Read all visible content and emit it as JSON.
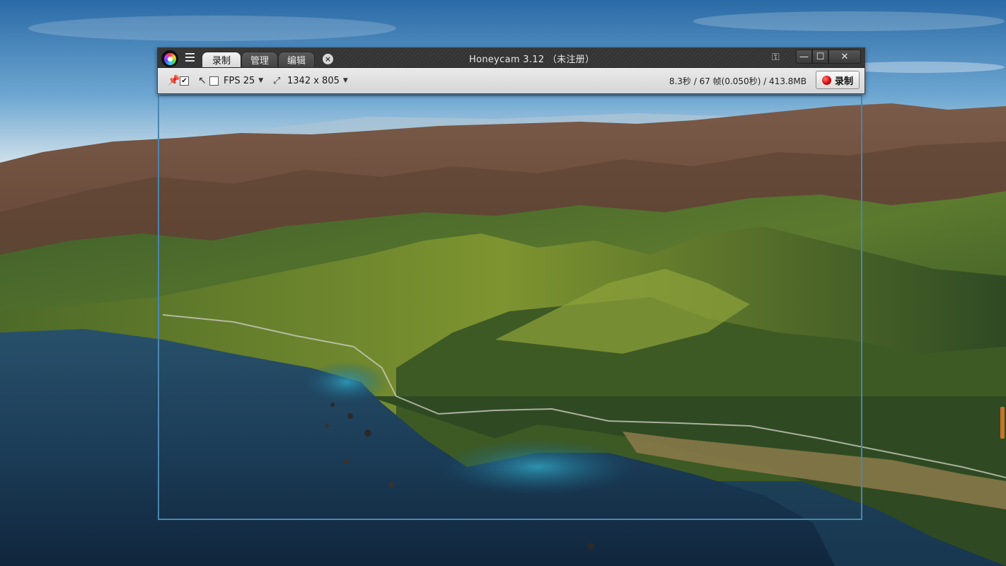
{
  "window": {
    "title": "Honeycam 3.12 （未注册）",
    "tabs": [
      {
        "label": "录制",
        "active": true
      },
      {
        "label": "管理",
        "active": false
      },
      {
        "label": "编辑",
        "active": false
      }
    ],
    "tab_close_glyph": "×",
    "controls": {
      "minimize": "—",
      "maximize": "☐",
      "close": "✕"
    },
    "key_glyph": "⚿"
  },
  "toolbar": {
    "pin_checked": true,
    "pin_check_glyph": "✔",
    "cursor_checked": false,
    "fps": "FPS 25",
    "size": "1342 x 805",
    "caret": "▼",
    "stats": "8.3秒 / 67 帧(0.050秒) / 413.8MB",
    "record_label": "录制"
  },
  "icons": {
    "app": "honeycam-logo-icon",
    "menu": "hamburger-menu-icon",
    "pin": "pin-icon",
    "cursor": "mouse-cursor-icon",
    "size": "resize-icon",
    "record": "record-dot-icon",
    "key": "key-icon"
  },
  "colors": {
    "capture_frame": "#4a86b0",
    "record_dot": "#d10000",
    "titlebar": "#3a3a3a",
    "toolbar": "#e0e0e0"
  }
}
